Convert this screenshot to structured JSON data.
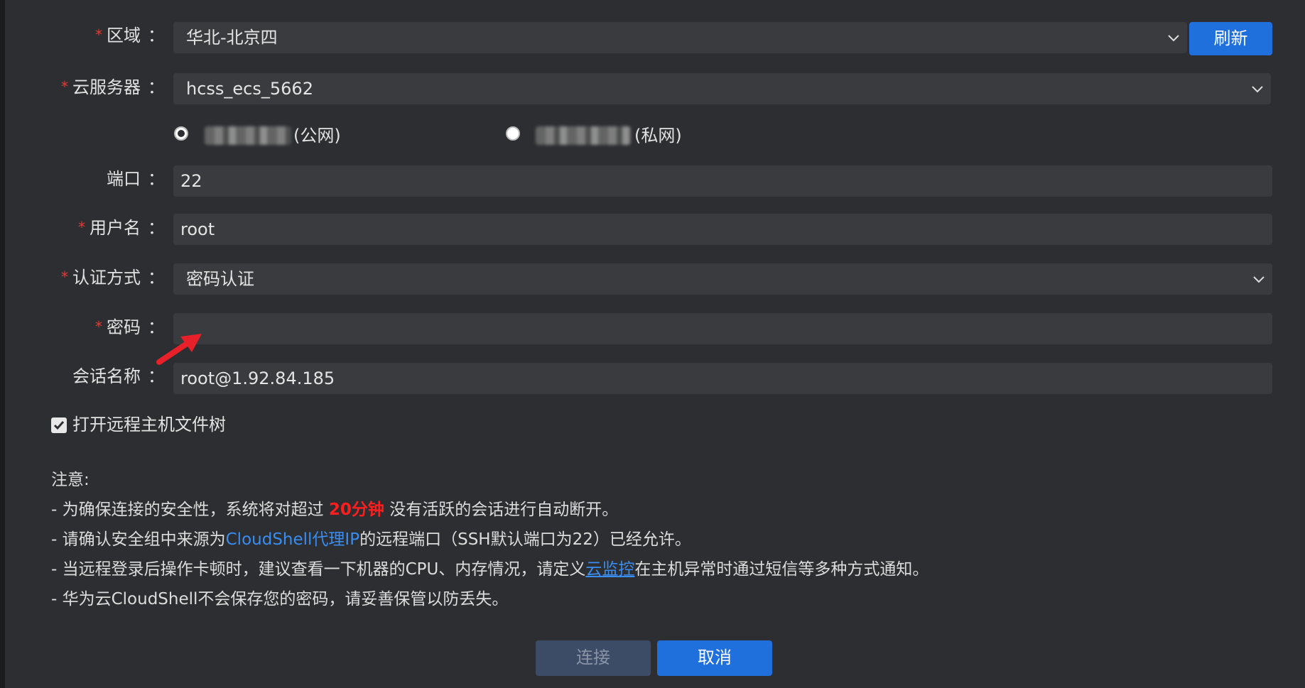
{
  "form": {
    "region": {
      "label": "区域",
      "value": "华北-北京四",
      "refresh_label": "刷新"
    },
    "server": {
      "label": "云服务器",
      "value": "hcss_ecs_5662"
    },
    "ip_options": {
      "public_label": "(公网)",
      "private_label": "(私网)"
    },
    "port": {
      "label": "端口",
      "value": "22"
    },
    "username": {
      "label": "用户名",
      "value": "root"
    },
    "auth": {
      "label": "认证方式",
      "value": "密码认证"
    },
    "password": {
      "label": "密码",
      "value": ""
    },
    "session": {
      "label": "会话名称",
      "value": "root@1.92.84.185"
    },
    "colon": "：",
    "required_mark": "*"
  },
  "file_tree": {
    "label": "打开远程主机文件树",
    "checked": true
  },
  "notes": {
    "title": "注意:",
    "line1_pre": "- 为确保连接的安全性，系统将对超过 ",
    "line1_highlight": "20分钟",
    "line1_post": " 没有活跃的会话进行自动断开。",
    "line2_pre": "- 请确认安全组中来源为",
    "line2_highlight": "CloudShell代理IP",
    "line2_post": "的远程端口（SSH默认端口为22）已经允许。",
    "line3_pre": "- 当远程登录后操作卡顿时，建议查看一下机器的CPU、内存情况，请定义",
    "line3_link": "云监控",
    "line3_post": "在主机异常时通过短信等多种方式通知。",
    "line4": "- 华为云CloudShell不会保存您的密码，请妥善保管以防丢失。"
  },
  "actions": {
    "connect_label": "连接",
    "cancel_label": "取消"
  },
  "colors": {
    "accent": "#1f6fdd",
    "required": "#e53935",
    "highlight": "#ff1e1e",
    "link": "#3a8df0",
    "arrow": "#e8202a"
  }
}
